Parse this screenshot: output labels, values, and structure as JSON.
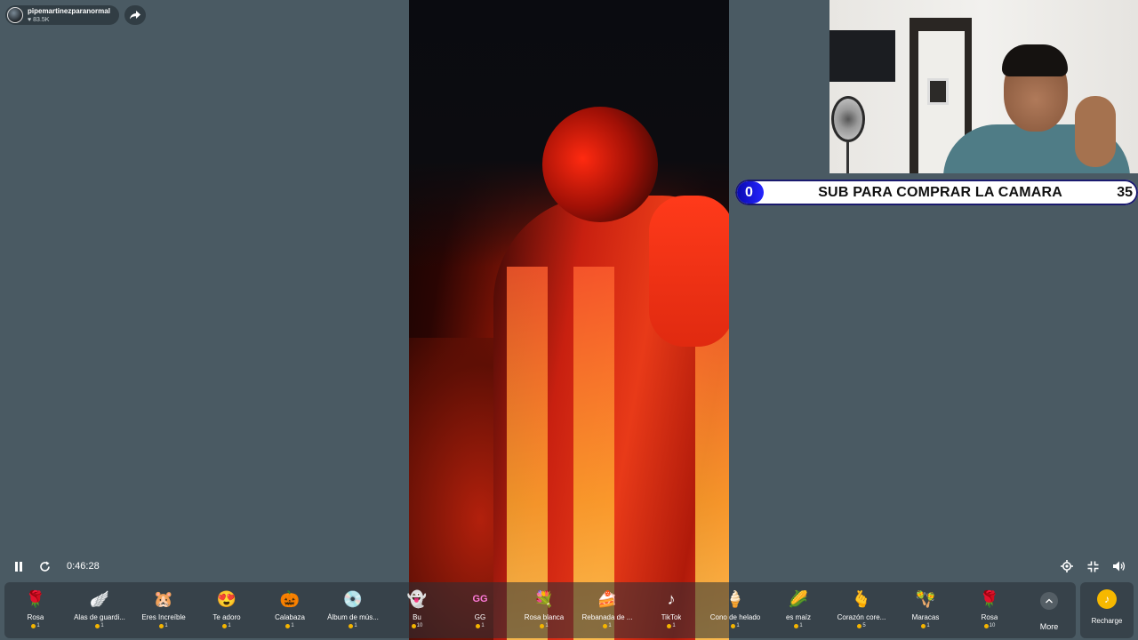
{
  "streamer": {
    "name": "pipemartinezparanormal",
    "likes": "83.5K"
  },
  "goal": {
    "current": "0",
    "title": "SUB PARA COMPRAR LA CAMARA",
    "target": "35"
  },
  "player": {
    "elapsed": "0:46:28"
  },
  "gifts": [
    {
      "name": "Rosa",
      "price": "1",
      "icon": "rose-icon",
      "glyph": "🌹"
    },
    {
      "name": "Alas de guardi...",
      "price": "1",
      "icon": "wings-icon",
      "glyph": "🪽"
    },
    {
      "name": "Eres Increíble",
      "price": "1",
      "icon": "hamster-icon",
      "glyph": "🐹"
    },
    {
      "name": "Te adoro",
      "price": "1",
      "icon": "heart-icon",
      "glyph": "😍"
    },
    {
      "name": "Calabaza",
      "price": "1",
      "icon": "pumpkin-icon",
      "glyph": "🎃"
    },
    {
      "name": "Álbum de mús...",
      "price": "1",
      "icon": "music-album-icon",
      "glyph": "💿"
    },
    {
      "name": "Bu",
      "price": "10",
      "icon": "ghost-icon",
      "glyph": "👻"
    },
    {
      "name": "GG",
      "price": "1",
      "icon": "gg-icon",
      "glyph": "GG"
    },
    {
      "name": "Rosa blanca",
      "price": "1",
      "icon": "white-rose-icon",
      "glyph": "💐"
    },
    {
      "name": "Rebanada de ...",
      "price": "1",
      "icon": "cake-slice-icon",
      "glyph": "🍰"
    },
    {
      "name": "TikTok",
      "price": "1",
      "icon": "tiktok-icon",
      "glyph": "♪"
    },
    {
      "name": "Cono de helado",
      "price": "1",
      "icon": "ice-cream-icon",
      "glyph": "🍦"
    },
    {
      "name": "es maíz",
      "price": "1",
      "icon": "corn-icon",
      "glyph": "🌽"
    },
    {
      "name": "Corazón core...",
      "price": "5",
      "icon": "finger-heart-icon",
      "glyph": "🫰"
    },
    {
      "name": "Maracas",
      "price": "1",
      "icon": "maracas-icon",
      "glyph": "🪇"
    },
    {
      "name": "Rosa",
      "price": "10",
      "icon": "rose-icon",
      "glyph": "🌹"
    }
  ],
  "more_label": "More",
  "recharge_label": "Recharge",
  "colors": {
    "background": "#4a5a63",
    "goal_accent": "#2424ff",
    "coin": "#f4b400"
  }
}
